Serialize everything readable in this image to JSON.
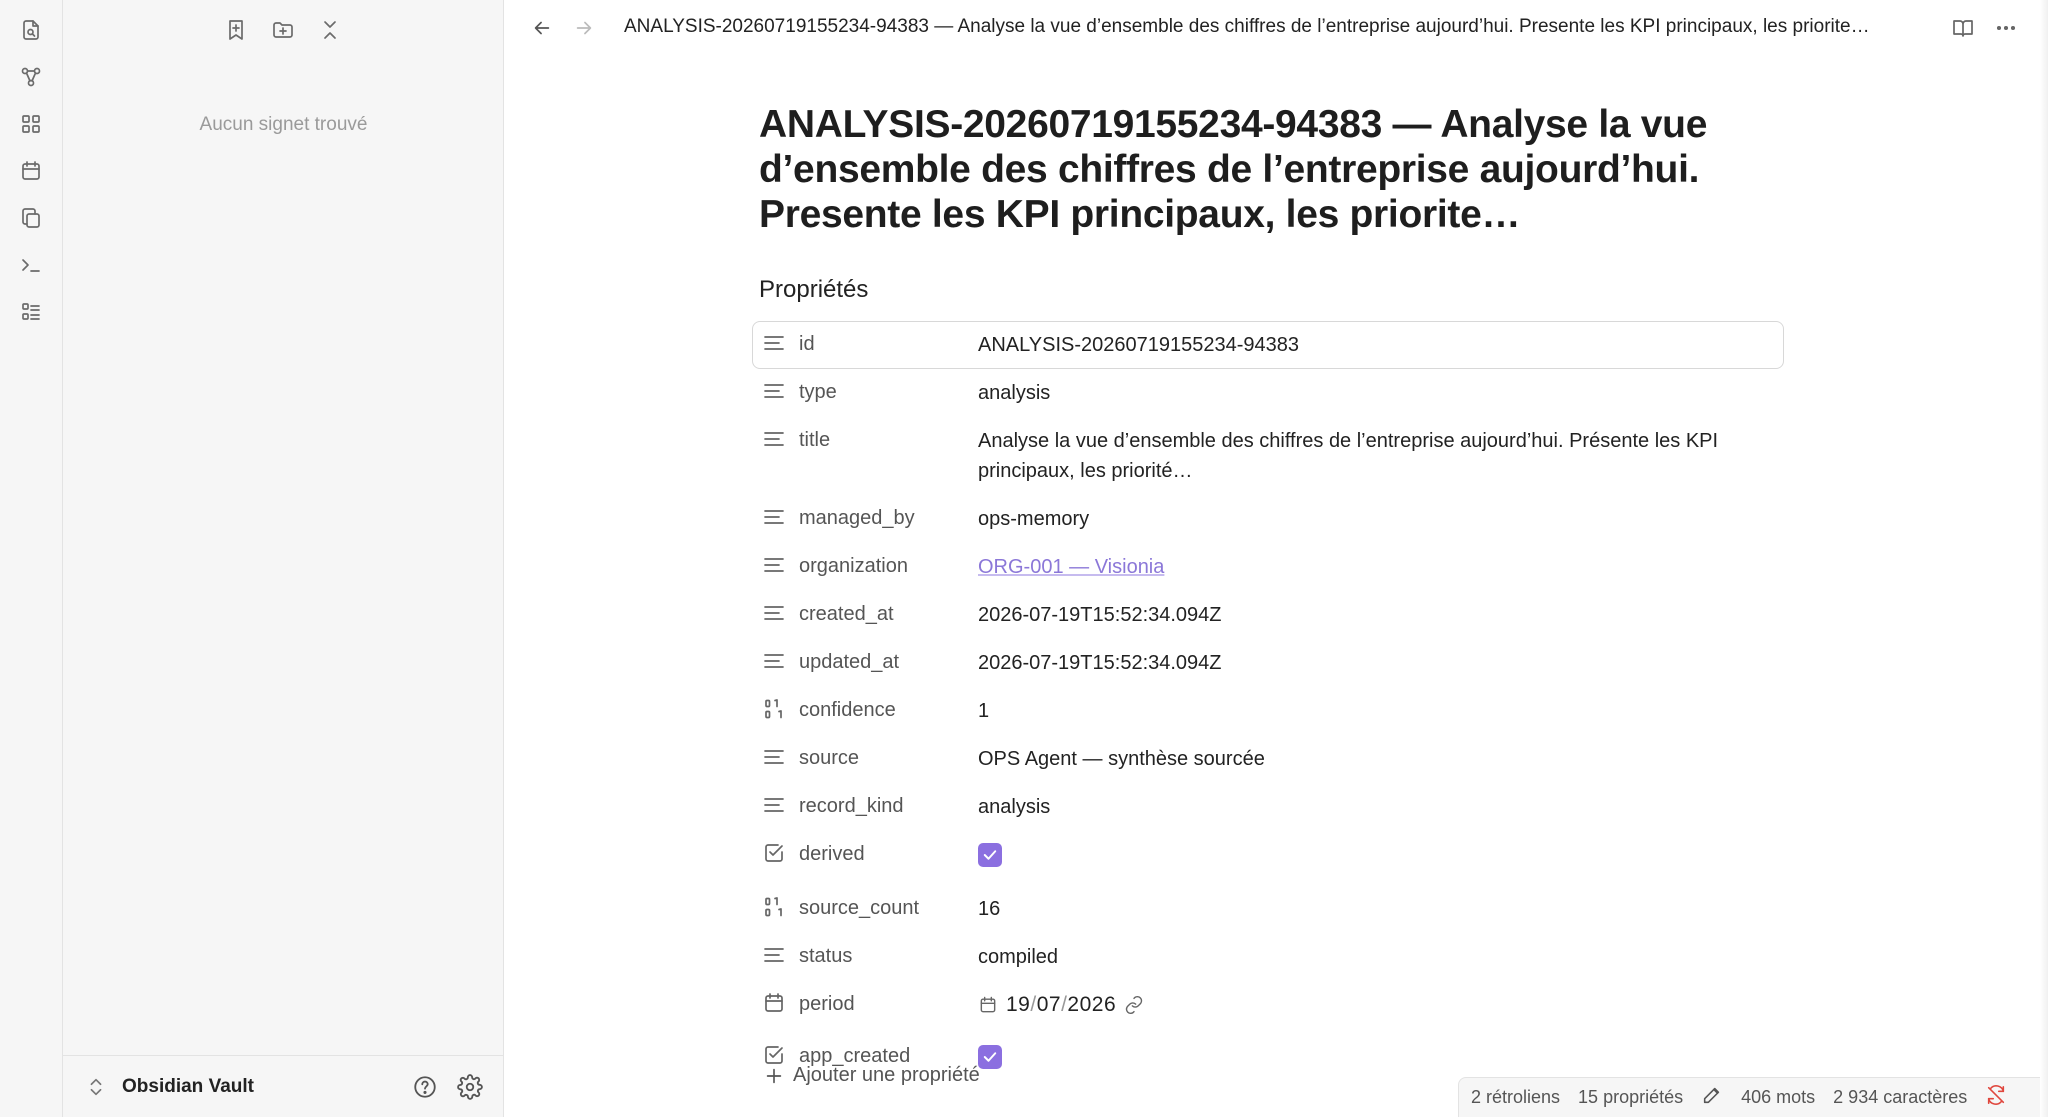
{
  "ribbon": {
    "icons": [
      "file-search-icon",
      "graph-icon",
      "grid-icon",
      "calendar-icon",
      "copy-icon",
      "terminal-icon",
      "list-icon"
    ]
  },
  "sidebar": {
    "tools": [
      "bookmark-add-icon",
      "folder-add-icon",
      "collapse-icon"
    ],
    "empty_text": "Aucun signet trouvé",
    "vault_name": "Obsidian Vault"
  },
  "header": {
    "tab_title": "ANALYSIS-20260719155234-94383 — Analyse la vue d’ensemble des chiffres de l’entreprise aujourd’hui. Presente les KPI principaux, les priorite…"
  },
  "document": {
    "title": "ANALYSIS-20260719155234-94383 — Analyse la vue d’ensemble des chiffres de l’entreprise aujourd’hui. Presente les KPI principaux, les priorite…",
    "properties_heading": "Propriétés",
    "properties": [
      {
        "key": "id",
        "value": "ANALYSIS-20260719155234-94383",
        "icon": "text-icon"
      },
      {
        "key": "type",
        "value": "analysis",
        "icon": "text-icon"
      },
      {
        "key": "title",
        "value": "Analyse la vue d’ensemble des chiffres de l’entreprise aujourd’hui. Présente les KPI principaux, les priorité…",
        "icon": "text-icon"
      },
      {
        "key": "managed_by",
        "value": "ops-memory",
        "icon": "text-icon"
      },
      {
        "key": "organization",
        "value": "ORG-001 — Visionia",
        "icon": "text-icon",
        "link": true
      },
      {
        "key": "created_at",
        "value": "2026-07-19T15:52:34.094Z",
        "icon": "text-icon"
      },
      {
        "key": "updated_at",
        "value": "2026-07-19T15:52:34.094Z",
        "icon": "text-icon"
      },
      {
        "key": "confidence",
        "value": "1",
        "icon": "number-icon"
      },
      {
        "key": "source",
        "value": "OPS Agent — synthèse sourcée",
        "icon": "text-icon"
      },
      {
        "key": "record_kind",
        "value": "analysis",
        "icon": "text-icon"
      },
      {
        "key": "derived",
        "value": true,
        "icon": "checkbox-icon"
      },
      {
        "key": "source_count",
        "value": "16",
        "icon": "number-icon"
      },
      {
        "key": "status",
        "value": "compiled",
        "icon": "text-icon"
      },
      {
        "key": "period",
        "value": {
          "day": "19",
          "month": "07",
          "year": "2026"
        },
        "icon": "calendar-icon"
      },
      {
        "key": "app_created",
        "value": true,
        "icon": "checkbox-icon"
      }
    ],
    "add_property_label": "Ajouter une propriété"
  },
  "status_bar": {
    "backlinks": "2 rétroliens",
    "properties": "15 propriétés",
    "words": "406 mots",
    "characters": "2 934 caractères"
  },
  "colors": {
    "accent": "#8b6fe0",
    "link": "#8b77d8",
    "sync_error": "#e0473e"
  }
}
